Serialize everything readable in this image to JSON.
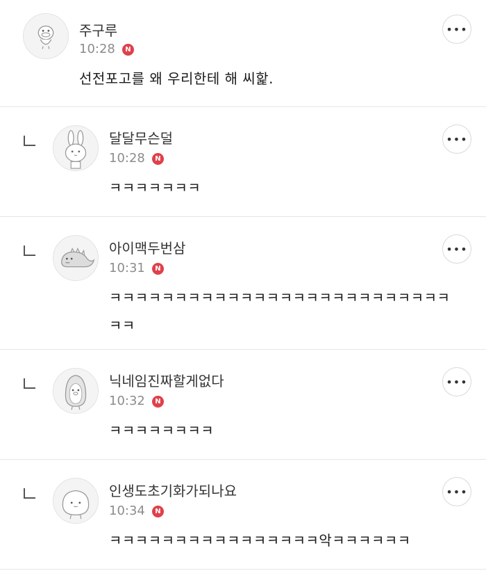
{
  "comments": [
    {
      "author": "주구루",
      "time": "10:28",
      "badge": "N",
      "text": "선전포고를 왜 우리한테 해 씨핥.",
      "is_reply": false,
      "avatar_icon": "duck-character-icon"
    },
    {
      "author": "달달무슨덜",
      "time": "10:28",
      "badge": "N",
      "text": "ㅋㅋㅋㅋㅋㅋㅋ",
      "is_reply": true,
      "avatar_icon": "rabbit-character-icon"
    },
    {
      "author": "아이맥두번삼",
      "time": "10:31",
      "badge": "N",
      "text": "ㅋㅋㅋㅋㅋㅋㅋㅋㅋㅋㅋㅋㅋㅋㅋㅋㅋㅋㅋㅋㅋㅋㅋㅋㅋㅋㅋㅋ",
      "is_reply": true,
      "avatar_icon": "dinosaur-character-icon"
    },
    {
      "author": "닉네임진짜할게없다",
      "time": "10:32",
      "badge": "N",
      "text": "ㅋㅋㅋㅋㅋㅋㅋㅋ",
      "is_reply": true,
      "avatar_icon": "penguin-character-icon"
    },
    {
      "author": "인생도초기화가되나요",
      "time": "10:34",
      "badge": "N",
      "text": "ㅋㅋㅋㅋㅋㅋㅋㅋㅋㅋㅋㅋㅋㅋㅋㅋ악ㅋㅋㅋㅋㅋㅋ",
      "is_reply": true,
      "avatar_icon": "blob-character-icon"
    }
  ],
  "more_button_label": "•••"
}
